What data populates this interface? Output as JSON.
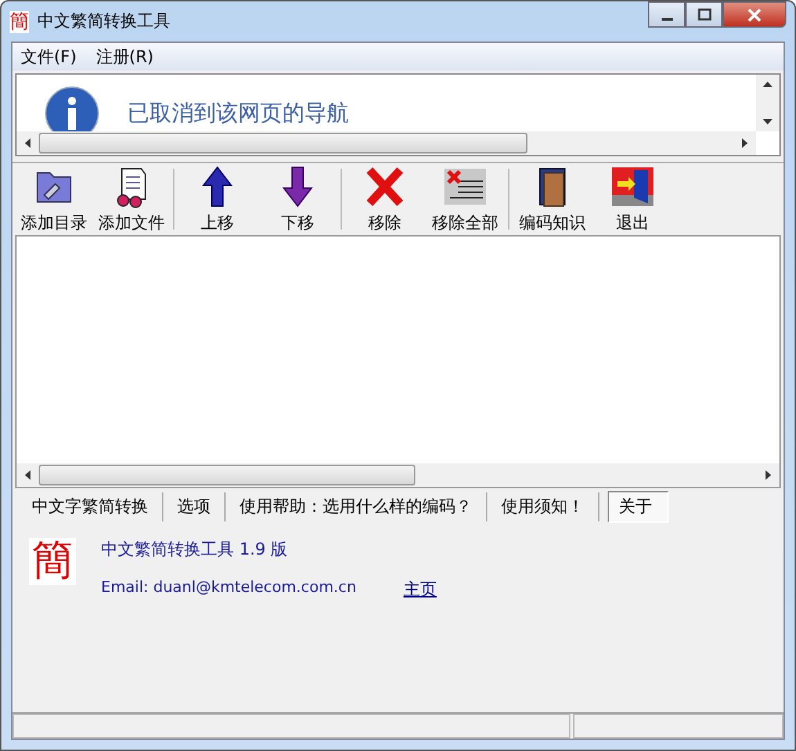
{
  "window": {
    "title": "中文繁简转换工具",
    "icon_glyph": "簡"
  },
  "menu": [
    "文件(F)",
    "注册(R)"
  ],
  "browser_pane": {
    "message": "已取消到该网页的导航"
  },
  "toolbar": [
    {
      "label": "添加目录",
      "kind": "folder"
    },
    {
      "label": "添加文件",
      "kind": "files"
    },
    {
      "label": "上移",
      "kind": "up"
    },
    {
      "label": "下移",
      "kind": "down"
    },
    {
      "label": "移除",
      "kind": "remove"
    },
    {
      "label": "移除全部",
      "kind": "remove_all"
    },
    {
      "label": "编码知识",
      "kind": "book"
    },
    {
      "label": "退出",
      "kind": "exit"
    }
  ],
  "tabs": [
    {
      "label": "中文字繁简转换",
      "selected": false
    },
    {
      "label": "选项",
      "selected": false
    },
    {
      "label": "使用帮助：选用什么样的编码？",
      "selected": false
    },
    {
      "label": "使用须知！",
      "selected": false
    },
    {
      "label": "关于",
      "selected": true
    }
  ],
  "about": {
    "logo_glyph": "簡",
    "product": "中文繁简转换工具 1.9 版",
    "email": "Email: duanl@kmtelecom.com.cn",
    "homepage_link": "主页"
  }
}
